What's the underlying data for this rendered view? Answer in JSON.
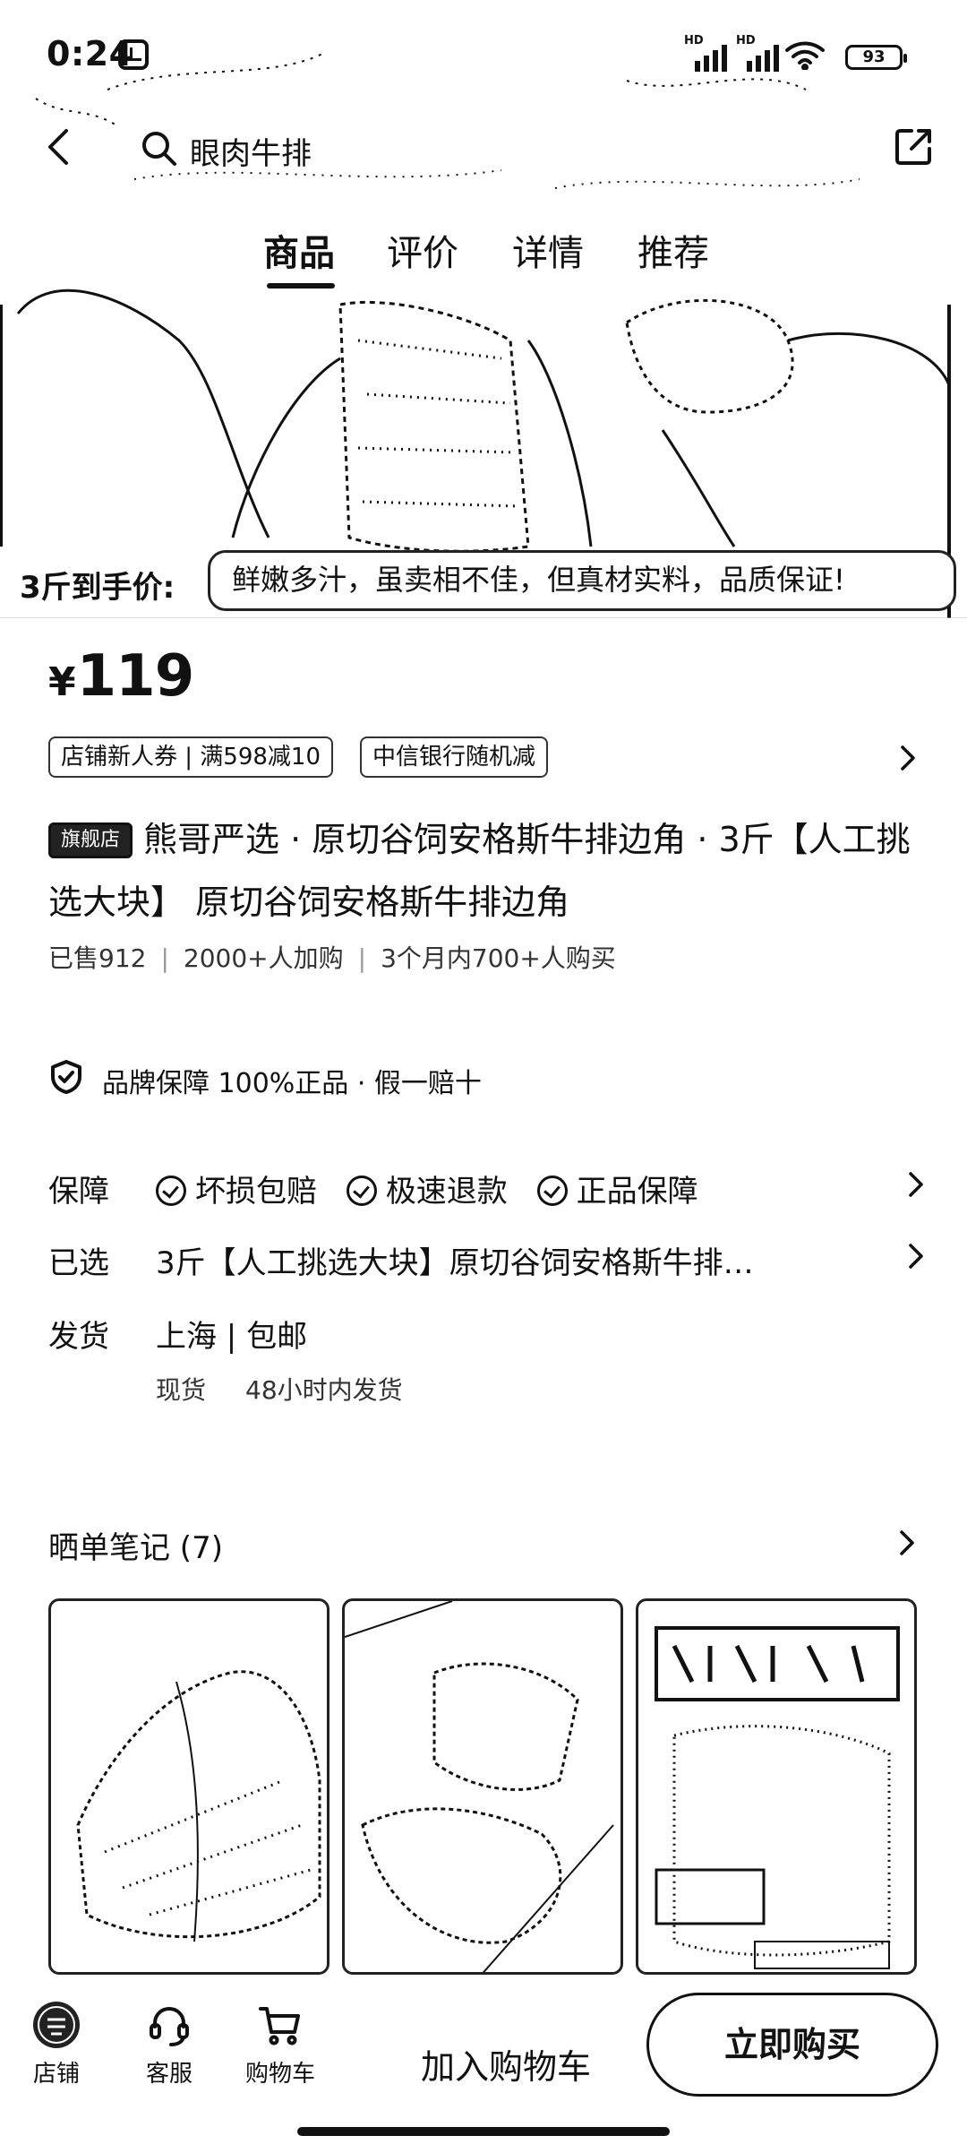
{
  "status_bar": {
    "time": "0:24",
    "network_label_1": "HD",
    "network_label_2": "HD",
    "battery": "93"
  },
  "nav": {
    "search_text": "眼肉牛排",
    "tabs": [
      {
        "label": "商品",
        "active": true
      },
      {
        "label": "评价",
        "active": false
      },
      {
        "label": "详情",
        "active": false
      },
      {
        "label": "推荐",
        "active": false
      }
    ]
  },
  "promo": {
    "left_label": "3斤到手价:",
    "slogan": "鲜嫩多汁，虽卖相不佳，但真材实料，品质保证!"
  },
  "price": {
    "symbol": "¥",
    "value": "119"
  },
  "coupons": [
    "店铺新人券 | 满598减10",
    "中信银行随机减"
  ],
  "product": {
    "badge": "旗舰店",
    "title": "熊哥严选 · 原切谷饲安格斯牛排边角 · 3斤【人工挑选大块】 原切谷饲安格斯牛排边角",
    "sold": "已售912",
    "added": "2000+人加购",
    "bought": "3个月内700+人购买"
  },
  "brand_guarantee": {
    "text": "品牌保障  100%正品 · 假一赔十"
  },
  "guarantee": {
    "key": "保障",
    "items": [
      "坏损包赔",
      "极速退款",
      "正品保障"
    ]
  },
  "selected": {
    "key": "已选",
    "value": "3斤【人工挑选大块】原切谷饲安格斯牛排…"
  },
  "shipping": {
    "key": "发货",
    "value": "上海 | 包邮",
    "stock": "现货",
    "time": "48小时内发货"
  },
  "notes": {
    "title": "晒单笔记 (7)"
  },
  "bottom_bar": {
    "store": "店铺",
    "service": "客服",
    "cart": "购物车",
    "add_to_cart": "加入购物车",
    "buy_now": "立即购买"
  }
}
